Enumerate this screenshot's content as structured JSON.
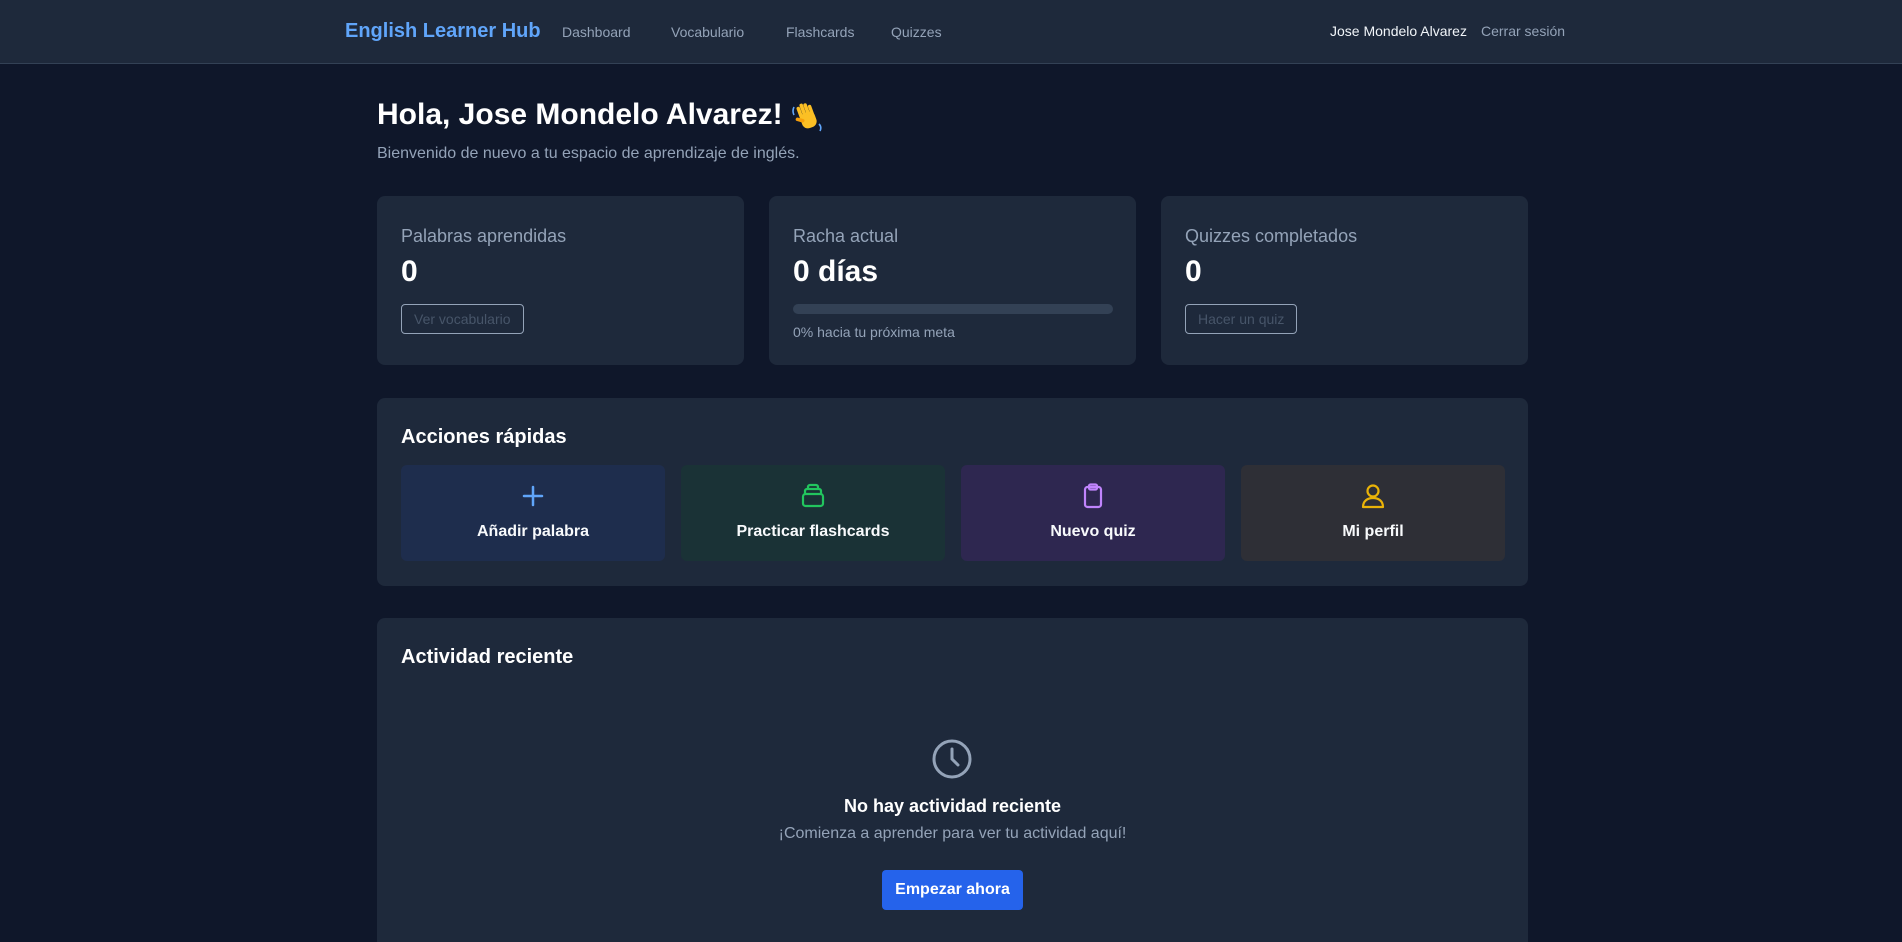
{
  "header": {
    "brand": "English Learner Hub",
    "nav": [
      "Dashboard",
      "Vocabulario",
      "Flashcards",
      "Quizzes"
    ],
    "user_name": "Jose Mondelo Alvarez",
    "logout": "Cerrar sesión"
  },
  "greeting": {
    "title": "Hola, Jose Mondelo Alvarez!",
    "emoji_icon": "waving-hand-icon",
    "subtitle": "Bienvenido de nuevo a tu espacio de aprendizaje de inglés."
  },
  "stats": {
    "words": {
      "label": "Palabras aprendidas",
      "value": "0",
      "button": "Ver vocabulario"
    },
    "streak": {
      "label": "Racha actual",
      "value": "0 días",
      "progress_percent": 0,
      "progress_text": "0% hacia tu próxima meta"
    },
    "quizzes": {
      "label": "Quizzes completados",
      "value": "0",
      "button": "Hacer un quiz"
    }
  },
  "quick_actions": {
    "title": "Acciones rápidas",
    "items": [
      {
        "label": "Añadir palabra",
        "icon": "plus-icon",
        "color": "#60a5fa",
        "bg": "#1e2d4d"
      },
      {
        "label": "Practicar flashcards",
        "icon": "card-stack-icon",
        "color": "#22c55e",
        "bg": "#1a3236"
      },
      {
        "label": "Nuevo quiz",
        "icon": "clipboard-icon",
        "color": "#c084fc",
        "bg": "#2e2750"
      },
      {
        "label": "Mi perfil",
        "icon": "user-icon",
        "color": "#eab308",
        "bg": "#2e2f36"
      }
    ]
  },
  "recent_activity": {
    "title": "Actividad reciente",
    "empty_icon": "clock-icon",
    "empty_title": "No hay actividad reciente",
    "empty_subtitle": "¡Comienza a aprender para ver tu actividad aquí!",
    "cta": "Empezar ahora"
  }
}
